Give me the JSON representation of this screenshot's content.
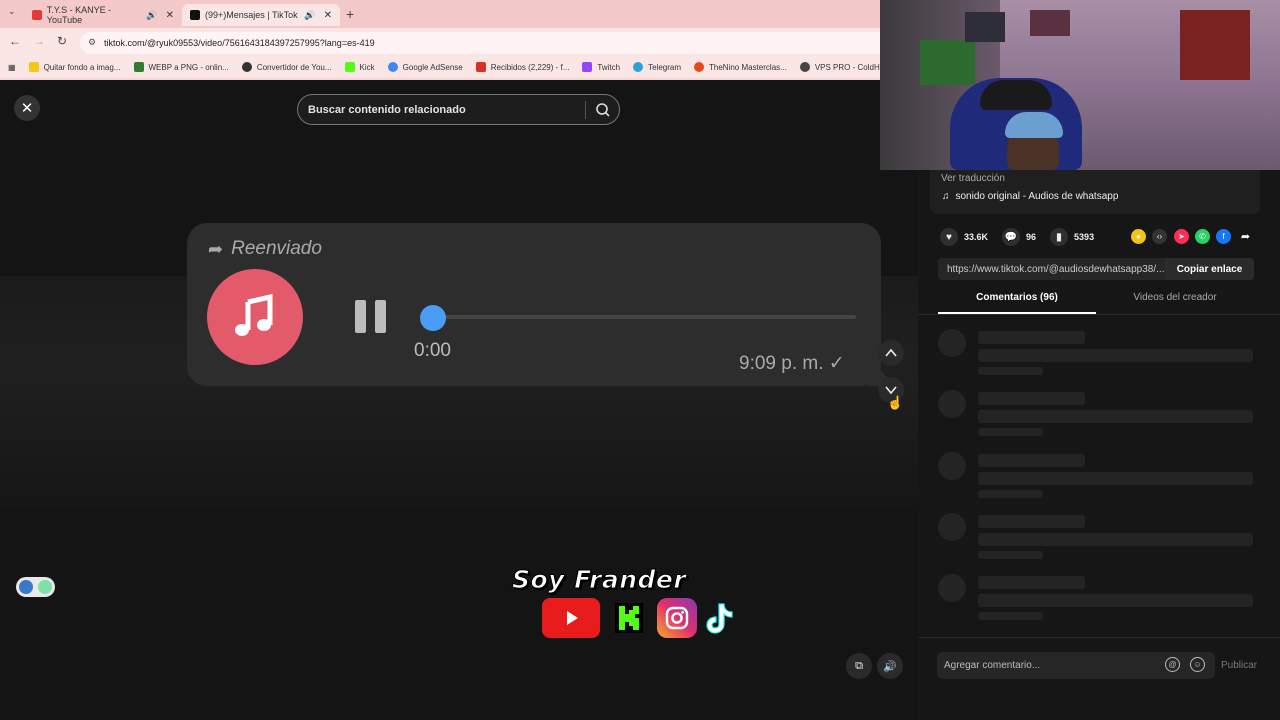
{
  "browser": {
    "tabs": [
      {
        "label": "T.Y.S - KANYE - YouTube",
        "favicon_color": "#e53935"
      },
      {
        "label": "(99+)Mensajes | TikTok",
        "favicon_color": "#111111"
      }
    ],
    "new_tab": "+",
    "url": "tiktok.com/@ryuk09553/video/7561643184397257995?lang=es-419",
    "bookmarks": [
      {
        "label": "Quitar fondo a imag...",
        "color": "#f5c518"
      },
      {
        "label": "WEBP a PNG - onlin...",
        "color": "#2e7d32"
      },
      {
        "label": "Convertidor de You...",
        "color": "#333333"
      },
      {
        "label": "Kick",
        "color": "#53fc18"
      },
      {
        "label": "Google AdSense",
        "color": "#4285f4"
      },
      {
        "label": "Recibidos (2,229) - f...",
        "color": "#d93025"
      },
      {
        "label": "Twitch",
        "color": "#9146ff"
      },
      {
        "label": "Telegram",
        "color": "#2aa1da"
      },
      {
        "label": "TheNino Masterclas...",
        "color": "#e64a19"
      },
      {
        "label": "VPS PRO - ColdHost...",
        "color": "#444444"
      }
    ]
  },
  "video": {
    "search_placeholder": "Buscar contenido relacionado",
    "forwarded_label": "Reenviado",
    "audio_current_time": "0:00",
    "message_time": "9:09 p. m. ✓",
    "watermark": "Soy Frander",
    "social_icons": [
      "youtube-icon",
      "kick-icon",
      "instagram-icon",
      "tiktok-icon"
    ]
  },
  "panel": {
    "translate_link": "Ver traducción",
    "sound": "sonido original - Audios de whatsapp",
    "likes": "33.6K",
    "comments_count": "96",
    "saves": "5393",
    "share_link": "https://www.tiktok.com/@audiosdewhatsapp38/...",
    "copy_label": "Copiar enlace",
    "tabs": [
      "Comentarios (96)",
      "Videos del creador"
    ],
    "comment_placeholder": "Agregar comentario...",
    "publish_label": "Publicar"
  },
  "colors": {
    "accent_blue": "#4b9cf5",
    "music_pink": "#e35a6a",
    "tab_strip": "#f3c9c9"
  }
}
